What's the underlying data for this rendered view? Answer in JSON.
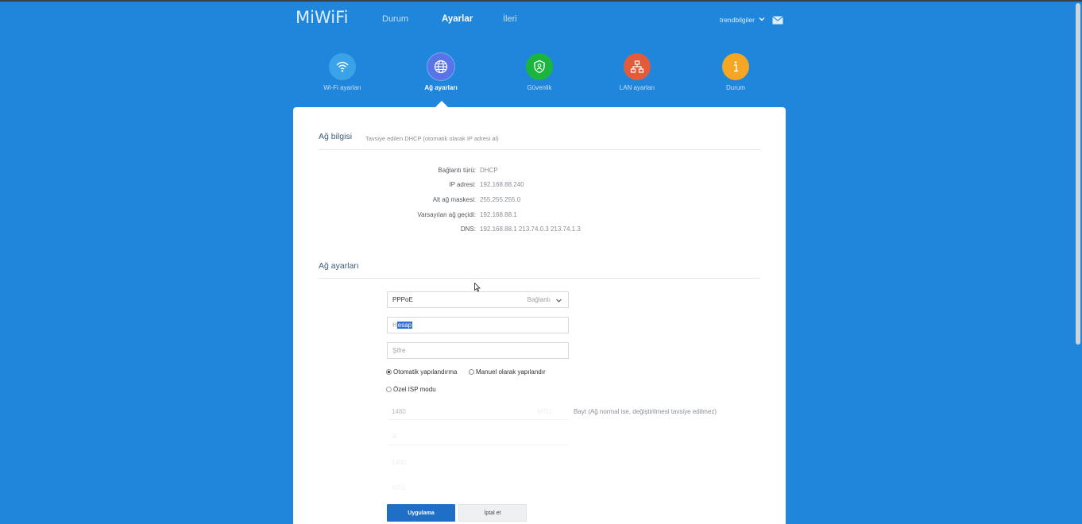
{
  "header": {
    "logo": "MiWiFi",
    "nav": [
      {
        "label": "Durum",
        "active": false
      },
      {
        "label": "Ayarlar",
        "active": true
      },
      {
        "label": "İleri",
        "active": false
      }
    ],
    "user": "trendbilgiler"
  },
  "tabs": [
    {
      "label": "Wi-Fi ayarları",
      "icon": "wifi-icon",
      "color": "#3aa3e8"
    },
    {
      "label": "Ağ ayarları",
      "icon": "globe-icon",
      "color": "#5a73e8",
      "active": true
    },
    {
      "label": "Güvenlik",
      "icon": "shield-icon",
      "color": "#19b53f"
    },
    {
      "label": "LAN ayarları",
      "icon": "network-icon",
      "color": "#e25b3a"
    },
    {
      "label": "Durum",
      "icon": "info-icon",
      "color": "#f5a623"
    }
  ],
  "network_info": {
    "title": "Ağ bilgisi",
    "subtitle": "Tavsiye edilen DHCP (otomatik olarak IP adresi al)",
    "rows": [
      {
        "label": "Bağlantı türü:",
        "value": "DHCP"
      },
      {
        "label": "IP adresi:",
        "value": "192.168.88.240"
      },
      {
        "label": "Alt ağ maskesi:",
        "value": "255.255.255.0"
      },
      {
        "label": "Varsayılan ağ geçidi:",
        "value": "192.168.88.1"
      },
      {
        "label": "DNS:",
        "value": "192.168.88.1 213.74.0.3 213.74.1.3"
      }
    ]
  },
  "network_settings": {
    "title": "Ağ ayarları",
    "connection_select": {
      "value": "PPPoE",
      "hint": "Bağlantı"
    },
    "account": {
      "prefix": "H",
      "selected": "esap"
    },
    "password_placeholder": "Şifre",
    "radio_auto": "Otomatik yapılandırma",
    "radio_manual": "Manuel olarak yapılandır",
    "isp_mode": "Özel ISP modu",
    "mtu_value": "1480",
    "mtu_unit": "MTU",
    "mtu_note": "Bayt (Ağ normal ise, değiştirilmesi tavsiye edilmez)",
    "faint_1": "IP",
    "faint_2": "1480",
    "faint_3": "MTU"
  },
  "buttons": {
    "apply": "Uygulama",
    "cancel": "İptal et"
  }
}
